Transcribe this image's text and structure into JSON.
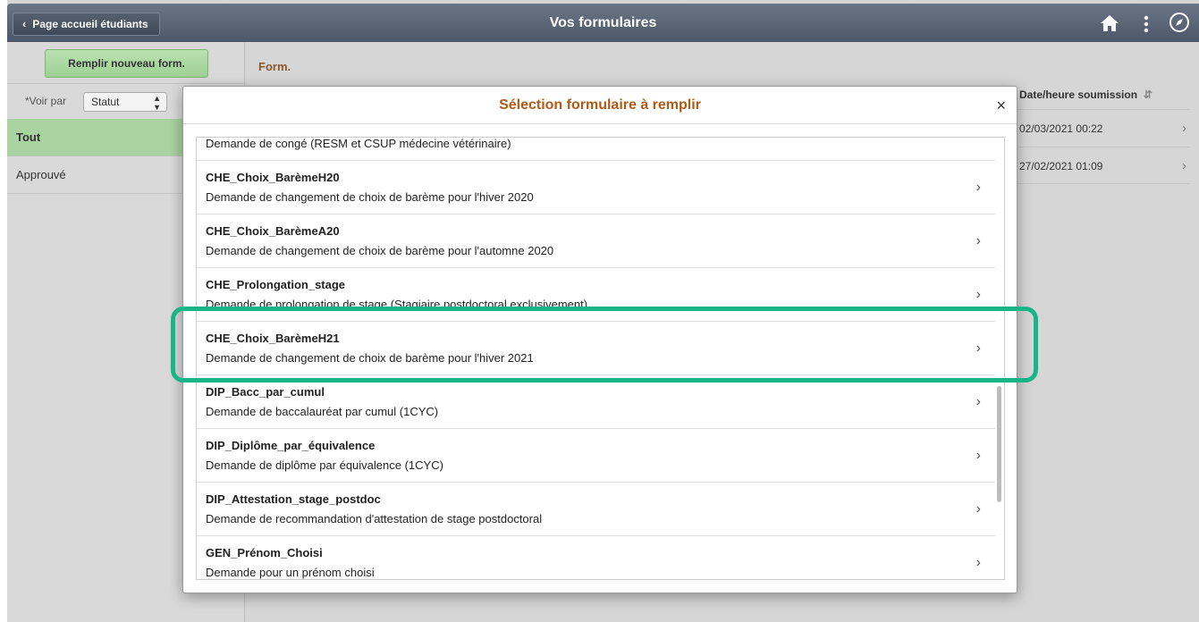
{
  "header": {
    "back_label": "Page accueil étudiants",
    "title": "Vos formulaires",
    "icons": [
      "home-icon",
      "kebab-menu-icon",
      "nav-bar-icon"
    ]
  },
  "left_panel": {
    "new_form_button": "Remplir nouveau form.",
    "filter_label": "*Voir par",
    "filter_value": "Statut",
    "statuses": [
      {
        "label": "Tout",
        "selected": true
      },
      {
        "label": "Approuvé",
        "selected": false
      }
    ]
  },
  "main": {
    "form_label": "Form.",
    "column_date": "Date/heure soumission",
    "rows": [
      {
        "date": "02/03/2021 00:22"
      },
      {
        "date": "27/02/2021 01:09"
      }
    ]
  },
  "modal": {
    "title": "Sélection formulaire à remplir",
    "close_label": "×",
    "items": [
      {
        "code": "",
        "desc": "Demande de congé (RESM et CSUP médecine vétérinaire)"
      },
      {
        "code": "CHE_Choix_BarèmeH20",
        "desc": "Demande de changement de choix de barème pour l'hiver 2020"
      },
      {
        "code": "CHE_Choix_BarèmeA20",
        "desc": "Demande de changement de choix de barème pour l'automne 2020"
      },
      {
        "code": "CHE_Prolongation_stage",
        "desc": "Demande de prolongation de stage (Stagiaire postdoctoral exclusivement)"
      },
      {
        "code": "CHE_Choix_BarèmeH21",
        "desc": "Demande de changement de choix de barème pour l'hiver 2021"
      },
      {
        "code": "DIP_Bacc_par_cumul",
        "desc": "Demande de baccalauréat par cumul (1CYC)"
      },
      {
        "code": "DIP_Diplôme_par_équivalence",
        "desc": "Demande de diplôme par équivalence (1CYC)"
      },
      {
        "code": "DIP_Attestation_stage_postdoc",
        "desc": "Demande de recommandation d'attestation de stage postdoctoral"
      },
      {
        "code": "GEN_Prénom_Choisi",
        "desc": "Demande pour un prénom choisi"
      }
    ]
  },
  "colors": {
    "header": "#5a6676",
    "accent_green": "#a9d3a0",
    "modal_title": "#b05a16",
    "highlight": "#17b587"
  }
}
